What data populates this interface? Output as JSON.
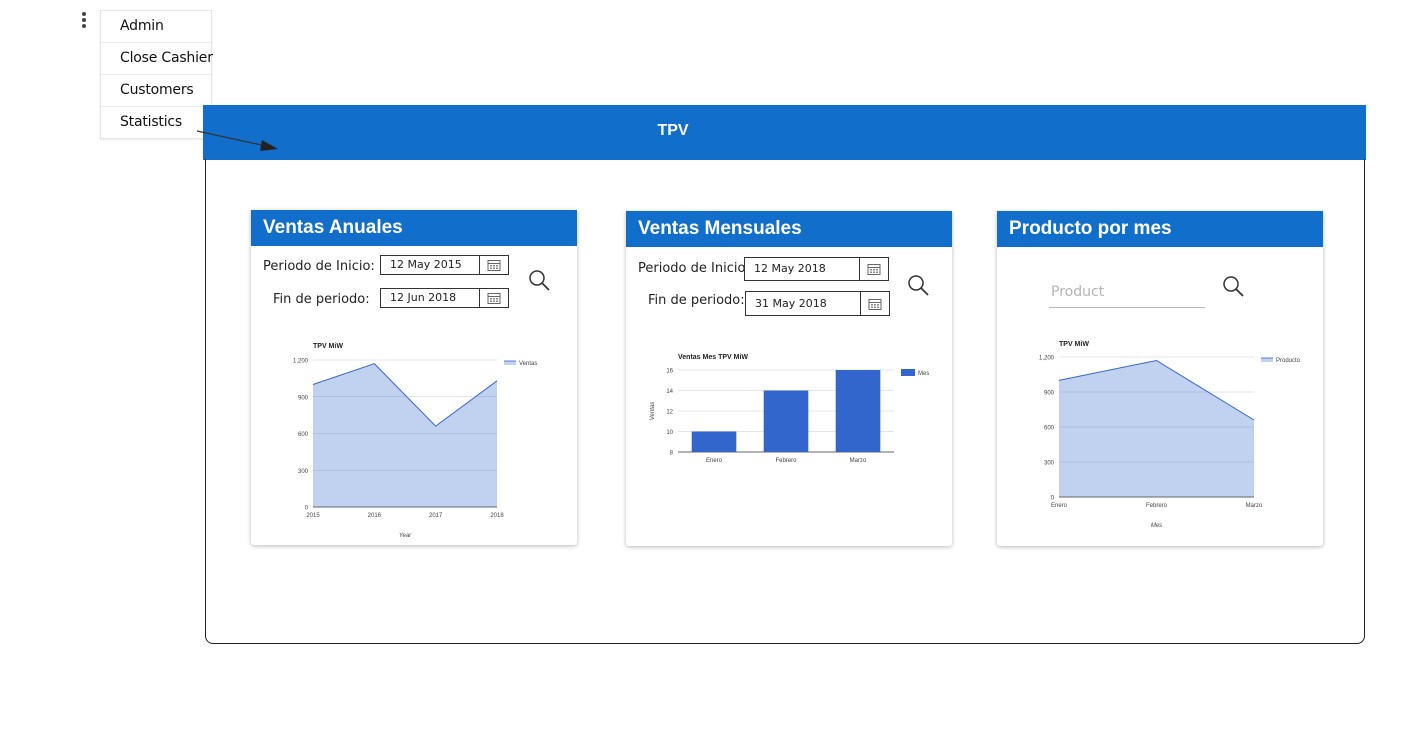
{
  "menu": {
    "items": [
      {
        "label": "Admin"
      },
      {
        "label": "Close Cashier"
      },
      {
        "label": "Customers"
      },
      {
        "label": "Statistics"
      }
    ]
  },
  "app_bar": {
    "title": "TPV",
    "color": "#126ecb"
  },
  "cards": {
    "annual": {
      "title": "Ventas Anuales",
      "start_label": "Periodo de Inicio:",
      "start_value": "12 May 2015",
      "end_label": "Fin de periodo:",
      "end_value": "12 Jun 2018"
    },
    "monthly": {
      "title": "Ventas Mensuales",
      "start_label": "Periodo de Inicio:",
      "start_value": "12 May 2018",
      "end_label": "Fin de periodo:",
      "end_value": "31 May 2018"
    },
    "product": {
      "title": "Producto por mes",
      "product_placeholder": "Product"
    }
  },
  "chart_data": [
    {
      "type": "area",
      "title": "TPV MiW",
      "xlabel": "Year",
      "ylabel": "",
      "categories": [
        "2015",
        "2016",
        "2017",
        "2018"
      ],
      "series": [
        {
          "name": "Ventas",
          "values": [
            1000,
            1170,
            660,
            1030
          ]
        }
      ],
      "ylim": [
        0,
        1200
      ],
      "yticks": [
        "0",
        "300",
        "600",
        "900",
        "1,200"
      ],
      "grid": true,
      "legend": "right",
      "color": "#3366cc"
    },
    {
      "type": "bar",
      "title": "Ventas Mes TPV MiW",
      "xlabel": "",
      "ylabel": "Ventas",
      "categories": [
        "Enero",
        "Febrero",
        "Marzo"
      ],
      "series": [
        {
          "name": "Mes",
          "values": [
            10,
            14,
            16
          ]
        }
      ],
      "ylim": [
        8,
        16
      ],
      "yticks": [
        "8",
        "10",
        "12",
        "14",
        "16"
      ],
      "grid": true,
      "legend": "right",
      "color": "#3366cc"
    },
    {
      "type": "area",
      "title": "TPV MiW",
      "xlabel": "Mes",
      "ylabel": "",
      "categories": [
        "Enero",
        "Febrero",
        "Marzo"
      ],
      "series": [
        {
          "name": "Producto",
          "values": [
            1000,
            1170,
            660
          ]
        }
      ],
      "ylim": [
        0,
        1200
      ],
      "yticks": [
        "0",
        "300",
        "600",
        "900",
        "1,200"
      ],
      "grid": true,
      "legend": "right",
      "color": "#3366cc"
    }
  ]
}
